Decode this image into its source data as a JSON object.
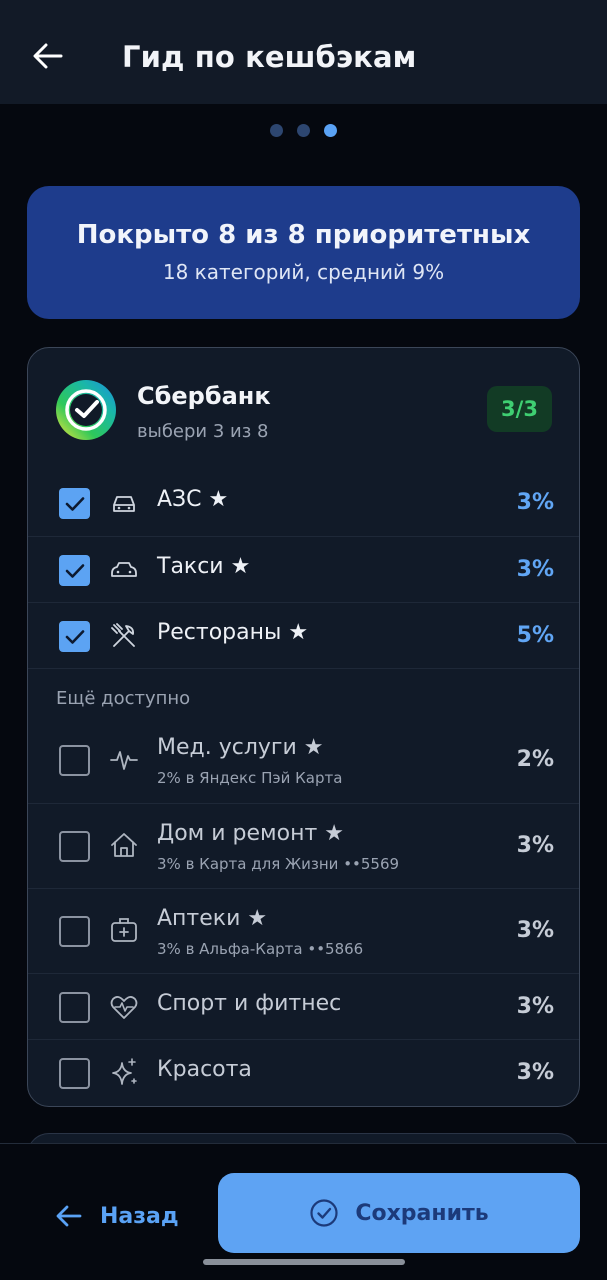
{
  "header": {
    "title": "Гид по кешбэкам"
  },
  "stepper": {
    "total": 3,
    "current": 3
  },
  "summary": {
    "title": "Покрыто 8 из 8 приоритетных",
    "subtitle": "18 категорий, средний 9%"
  },
  "bank": {
    "name": "Сбербанк",
    "hint": "выбери 3 из 8",
    "badge": "3/3",
    "selected": [
      {
        "label": "АЗС ★",
        "percent": "3%",
        "icon": "car-icon",
        "checked": true
      },
      {
        "label": "Такси ★",
        "percent": "3%",
        "icon": "taxi-icon",
        "checked": true
      },
      {
        "label": "Рестораны ★",
        "percent": "5%",
        "icon": "utensils-icon",
        "checked": true
      }
    ],
    "available_label": "Ещё доступно",
    "available": [
      {
        "label": "Мед. услуги ★",
        "sub": "2% в Яндекс Пэй Карта",
        "percent": "2%",
        "icon": "pulse-icon",
        "checked": false
      },
      {
        "label": "Дом и ремонт ★",
        "sub": "3% в Карта для Жизни ••5569",
        "percent": "3%",
        "icon": "house-icon",
        "checked": false
      },
      {
        "label": "Аптеки ★",
        "sub": "3% в Альфа-Карта ••5866",
        "percent": "3%",
        "icon": "first-aid-icon",
        "checked": false
      },
      {
        "label": "Спорт и фитнес",
        "percent": "3%",
        "icon": "heart-pulse-icon",
        "checked": false
      },
      {
        "label": "Красота",
        "percent": "3%",
        "icon": "sparkles-icon",
        "checked": false
      }
    ]
  },
  "footer": {
    "back_label": "Назад",
    "save_label": "Сохранить"
  },
  "colors": {
    "accent": "#5ea3f3",
    "banner": "#1e3c8c",
    "badge_text": "#3fcf72"
  }
}
